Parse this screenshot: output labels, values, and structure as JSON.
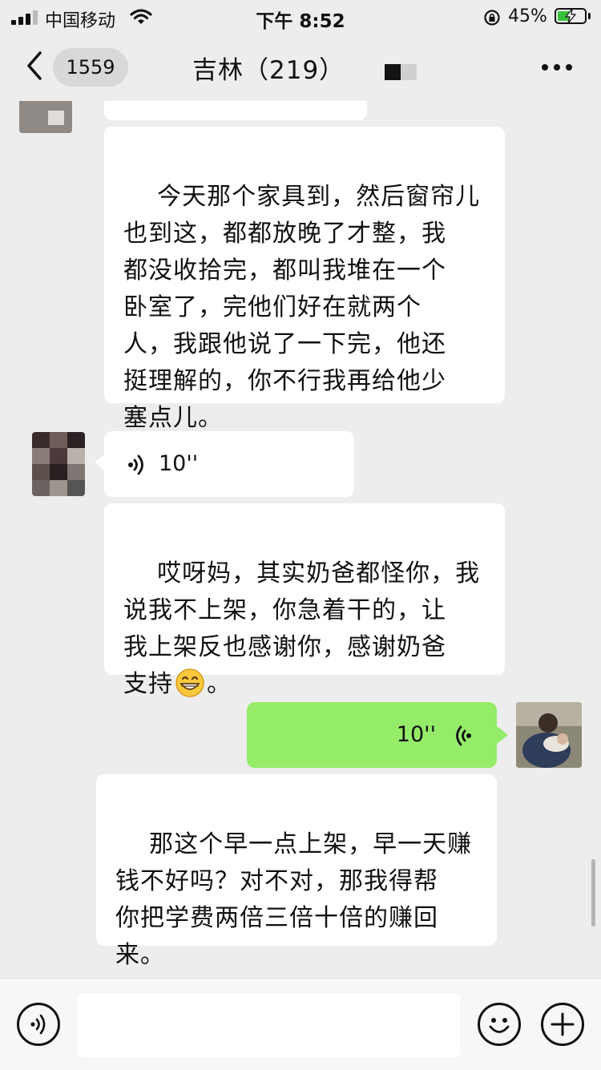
{
  "status_bar": {
    "carrier": "中国移动",
    "time": "下午 8:52",
    "battery_percent": "45%",
    "battery_level": 0.45,
    "icons": [
      "signal-icon",
      "wifi-icon",
      "rotation-lock-icon",
      "battery-charging-icon"
    ]
  },
  "nav": {
    "unread_count": "1559",
    "title": "吉林（219）",
    "icons": [
      "back-chevron-icon",
      "more-dots-icon"
    ]
  },
  "messages": [
    {
      "side": "left",
      "type": "text",
      "text": "",
      "partial": true
    },
    {
      "side": "left",
      "type": "text",
      "text": "今天那个家具到，然后窗帘儿\n也到这，都都放晚了才整，我\n都没收拾完，都叫我堆在一个\n卧室了，完他们好在就两个\n人，我跟他说了一下完，他还\n挺理解的，你不行我再给他少\n塞点儿。"
    },
    {
      "side": "left",
      "type": "voice",
      "duration": "10''"
    },
    {
      "side": "left",
      "type": "text",
      "text": "哎呀妈，其实奶爸都怪你，我\n说我不上架，你急着干的，让\n我上架反也感谢你，感谢奶爸\n支持",
      "emoji_suffix": "grinning-emoji",
      "suffix": "。"
    },
    {
      "side": "right",
      "type": "voice",
      "duration": "10''"
    },
    {
      "side": "right",
      "type": "text",
      "text": "那这个早一点上架，早一天赚\n钱不好吗？对不对，那我得帮\n你把学费两倍三倍十倍的赚回\n来。"
    }
  ],
  "input_bar": {
    "placeholder": "",
    "icons": [
      "voice-input-icon",
      "emoji-icon",
      "plus-icon"
    ]
  },
  "colors": {
    "background": "#ededed",
    "bubble_in": "#ffffff",
    "bubble_out": "#95ec69",
    "battery_fill": "#38c23a"
  }
}
